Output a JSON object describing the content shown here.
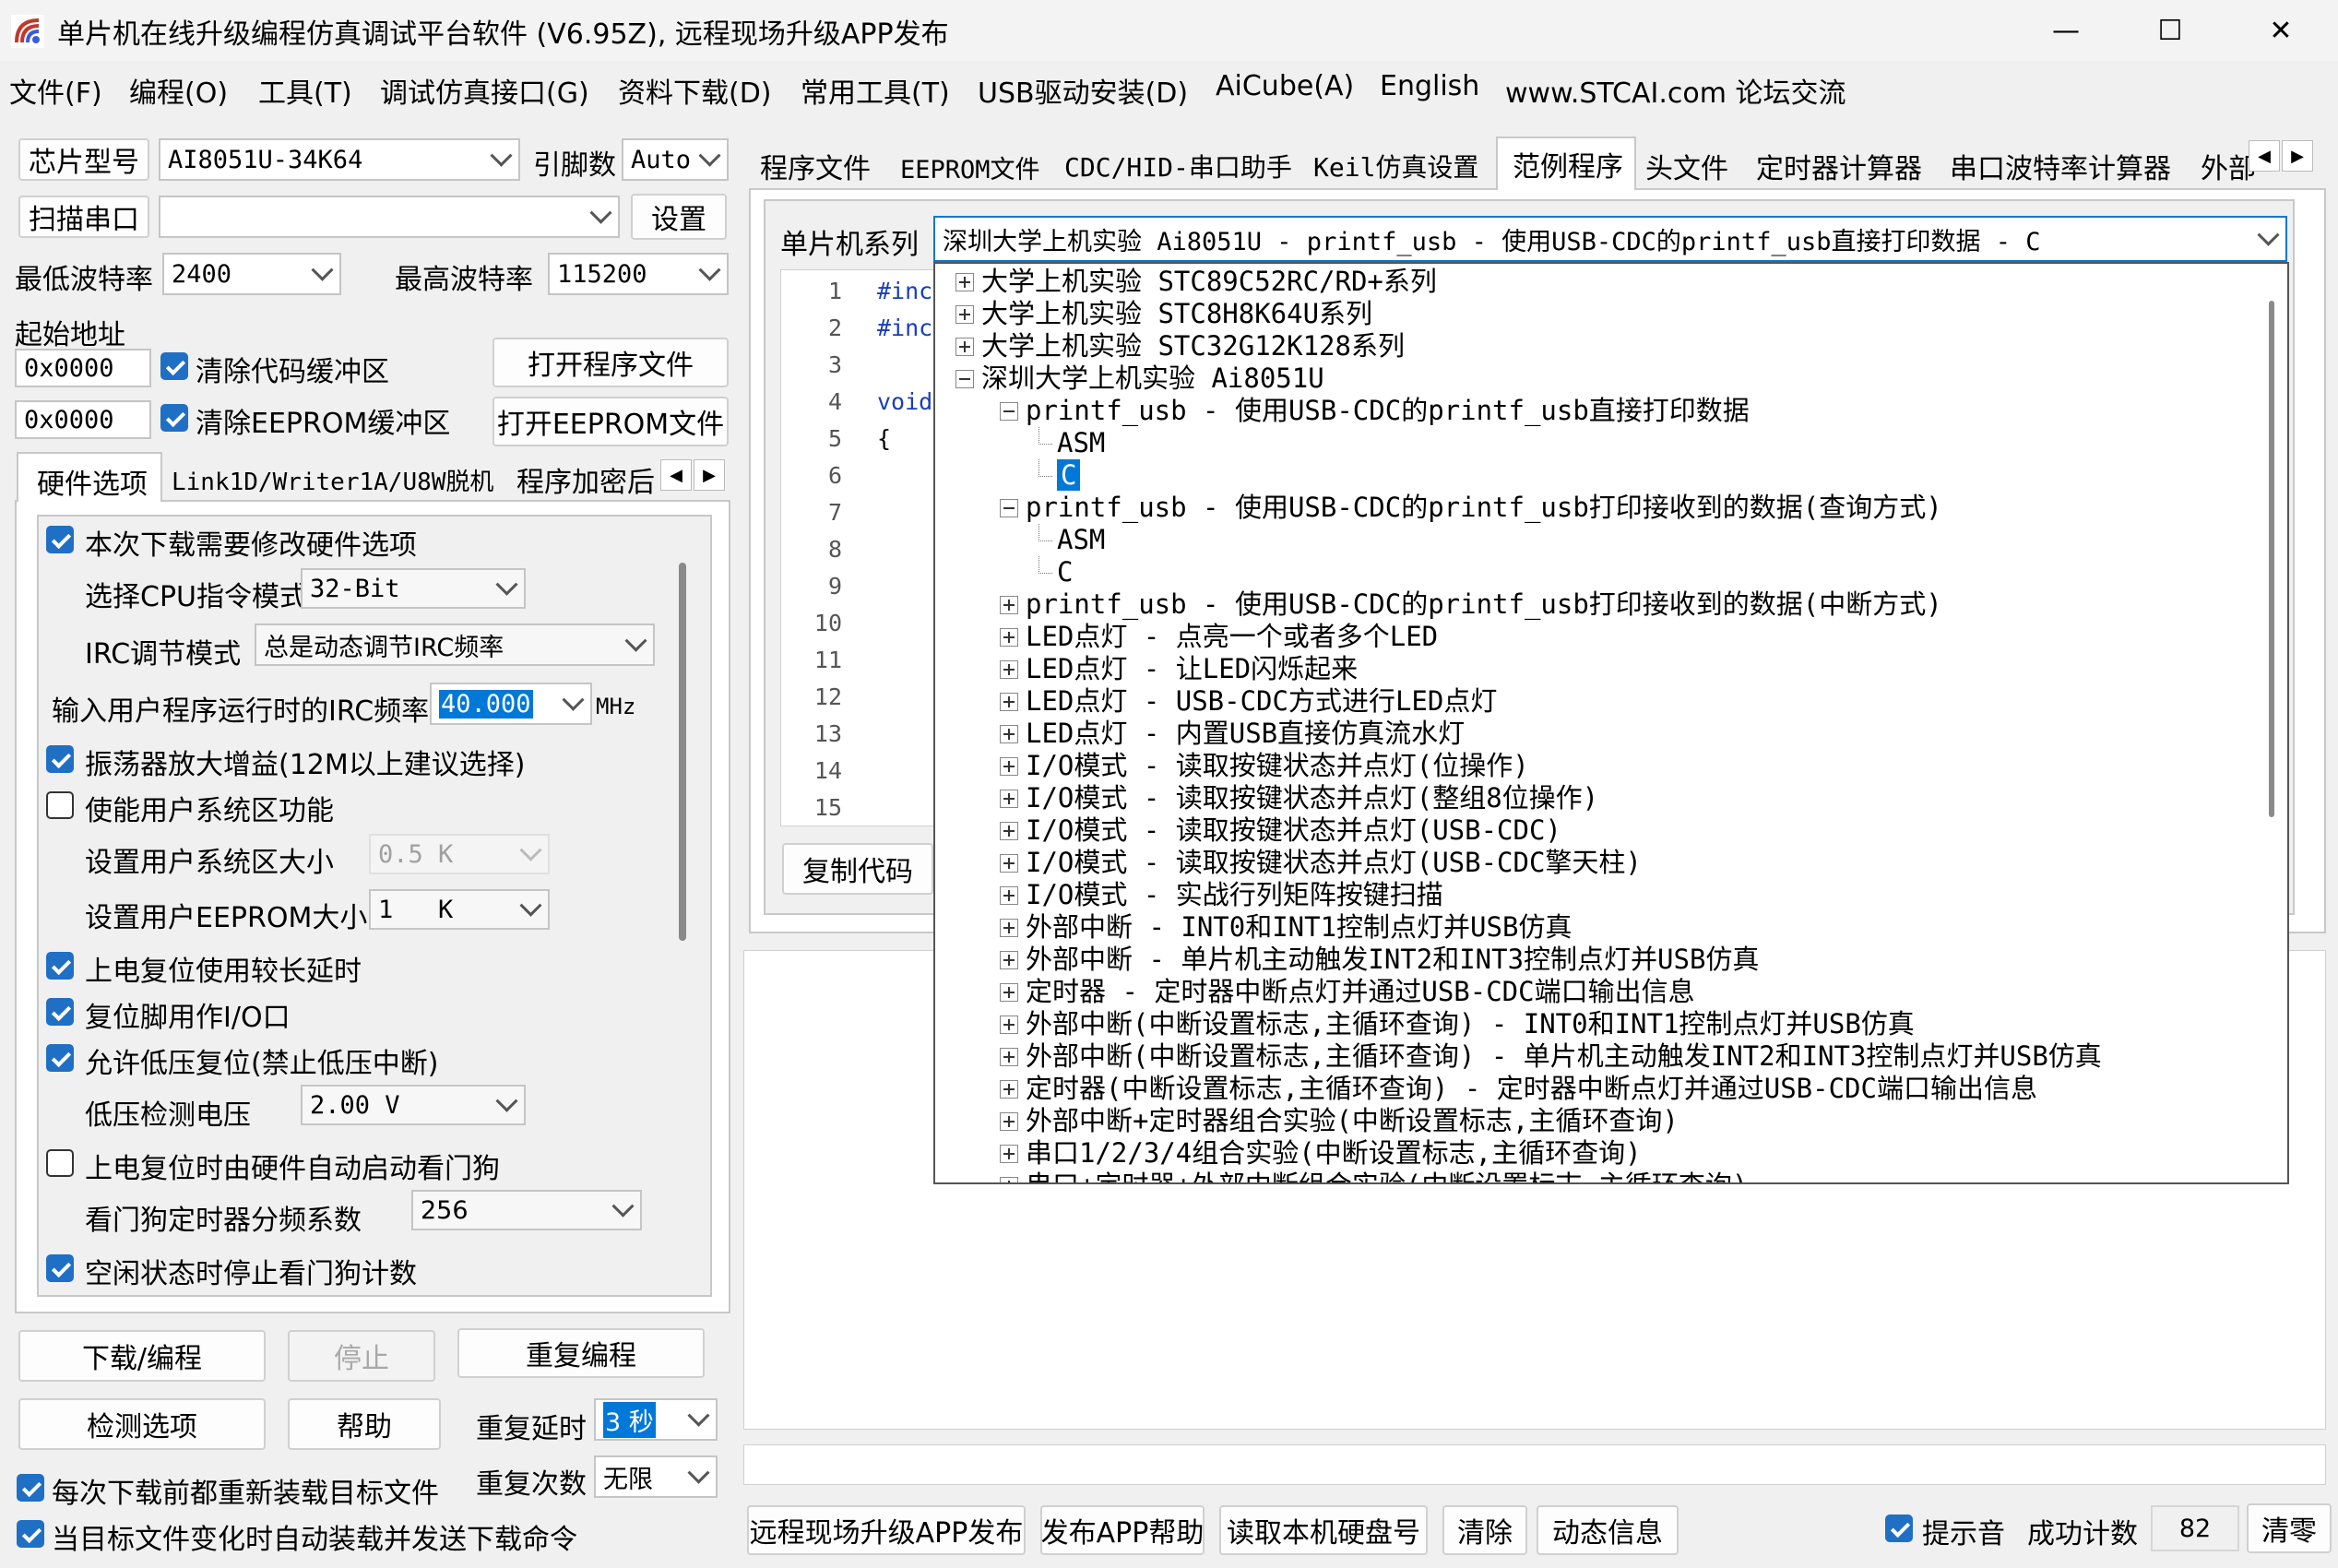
{
  "window": {
    "title": "单片机在线升级编程仿真调试平台软件 (V6.95Z), 远程现场升级APP发布",
    "minimize_glyph": "—",
    "maximize_glyph": "☐",
    "close_glyph": "✕"
  },
  "menu": [
    "文件(F)",
    "编程(O)",
    "工具(T)",
    "调试仿真接口(G)",
    "资料下载(D)",
    "常用工具(T)",
    "USB驱动安装(D)",
    "AiCube(A)",
    "English",
    "www.STCAI.com 论坛交流"
  ],
  "left": {
    "chip_btn": "芯片型号",
    "chip_value": "AI8051U-34K64",
    "pins_label": "引脚数",
    "pins_value": "Auto",
    "scan_btn": "扫描串口",
    "port_value": "",
    "settings_btn": "设置",
    "min_baud_label": "最低波特率",
    "min_baud": "2400",
    "max_baud_label": "最高波特率",
    "max_baud": "115200",
    "start_addr_label": "起始地址",
    "addr1": "0x0000",
    "clear_code": "清除代码缓冲区",
    "open_prog": "打开程序文件",
    "addr2": "0x0000",
    "clear_eeprom": "清除EEPROM缓冲区",
    "open_eeprom": "打开EEPROM文件",
    "tabs": [
      "硬件选项",
      "Link1D/Writer1A/U8W脱机",
      "程序加密后"
    ],
    "hw": {
      "modify_hw": "本次下载需要修改硬件选项",
      "cpu_mode_label": "选择CPU指令模式",
      "cpu_mode": "32-Bit",
      "irc_mode_label": "IRC调节模式",
      "irc_mode": "总是动态调节IRC频率",
      "irc_freq_label": "输入用户程序运行时的IRC频率",
      "irc_freq": "40.000",
      "irc_unit": "MHz",
      "osc_gain": "振荡器放大增益(12M以上建议选择)",
      "user_sys": "使能用户系统区功能",
      "user_sys_size_label": "设置用户系统区大小",
      "user_sys_size": "0.5 K",
      "user_eeprom_label": "设置用户EEPROM大小",
      "user_eeprom": "1   K",
      "long_delay": "上电复位使用较长延时",
      "reset_io": "复位脚用作I/O口",
      "lvr": "允许低压复位(禁止低压中断)",
      "lv_label": "低压检测电压",
      "lv_value": "2.00 V",
      "wdt_auto": "上电复位时由硬件自动启动看门狗",
      "wdt_div_label": "看门狗定时器分频系数",
      "wdt_div": "256",
      "idle_stop": "空闲状态时停止看门狗计数"
    },
    "download_btn": "下载/编程",
    "stop_btn": "停止",
    "reprog_btn": "重复编程",
    "detect_btn": "检测选项",
    "help_btn": "帮助",
    "repeat_delay_label": "重复延时",
    "repeat_delay": "3 秒",
    "reload": "每次下载前都重新装载目标文件",
    "repeat_count_label": "重复次数",
    "repeat_count": "无限",
    "auto_send": "当目标文件变化时自动装载并发送下载命令"
  },
  "right": {
    "tabs": [
      "程序文件",
      "EEPROM文件",
      "CDC/HID-串口助手",
      "Keil仿真设置",
      "范例程序",
      "头文件",
      "定时器计算器",
      "串口波特率计算器",
      "外部"
    ],
    "series_label": "单片机系列",
    "series_value": "深圳大学上机实验 Ai8051U - printf_usb - 使用USB-CDC的printf_usb直接打印数据 - C",
    "line_numbers": [
      "1",
      "2",
      "3",
      "4",
      "5",
      "6",
      "7",
      "8",
      "9",
      "10",
      "11",
      "12",
      "13",
      "14",
      "15"
    ],
    "code": [
      "#inc",
      "#inc",
      "",
      "void",
      "{"
    ],
    "copy_btn": "复制代码",
    "tree": [
      "大学上机实验 STC89C52RC/RD+系列",
      "大学上机实验 STC8H8K64U系列",
      "大学上机实验 STC32G12K128系列",
      "深圳大学上机实验 Ai8051U",
      "printf_usb - 使用USB-CDC的printf_usb直接打印数据",
      "ASM",
      "C",
      "printf_usb - 使用USB-CDC的printf_usb打印接收到的数据(查询方式)",
      "ASM",
      "C",
      "printf_usb - 使用USB-CDC的printf_usb打印接收到的数据(中断方式)",
      "LED点灯 - 点亮一个或者多个LED",
      "LED点灯 - 让LED闪烁起来",
      "LED点灯 - USB-CDC方式进行LED点灯",
      "LED点灯 - 内置USB直接仿真流水灯",
      "I/O模式 - 读取按键状态并点灯(位操作)",
      "I/O模式 - 读取按键状态并点灯(整组8位操作)",
      "I/O模式 - 读取按键状态并点灯(USB-CDC)",
      "I/O模式 - 读取按键状态并点灯(USB-CDC擎天柱)",
      "I/O模式 - 实战行列矩阵按键扫描",
      "外部中断 - INT0和INT1控制点灯并USB仿真",
      "外部中断 - 单片机主动触发INT2和INT3控制点灯并USB仿真",
      "定时器 - 定时器中断点灯并通过USB-CDC端口输出信息",
      "外部中断(中断设置标志,主循环查询) - INT0和INT1控制点灯并USB仿真",
      "外部中断(中断设置标志,主循环查询) - 单片机主动触发INT2和INT3控制点灯并USB仿真",
      "定时器(中断设置标志,主循环查询) - 定时器中断点灯并通过USB-CDC端口输出信息",
      "外部中断+定时器组合实验(中断设置标志,主循环查询)",
      "串口1/2/3/4组合实验(中断设置标志,主循环查询)",
      "串口+定时器+外部中断组合实验(中断设置标志,主循环查询)"
    ],
    "bottom": {
      "remote_btn": "远程现场升级APP发布",
      "app_help_btn": "发布APP帮助",
      "read_disk_btn": "读取本机硬盘号",
      "clear_btn": "清除",
      "dyn_btn": "动态信息",
      "beep": "提示音",
      "success_label": "成功计数",
      "success_count": "82",
      "reset_btn": "清零"
    }
  },
  "colors": {
    "accent": "#1f6fc5",
    "select": "#0078d7"
  }
}
